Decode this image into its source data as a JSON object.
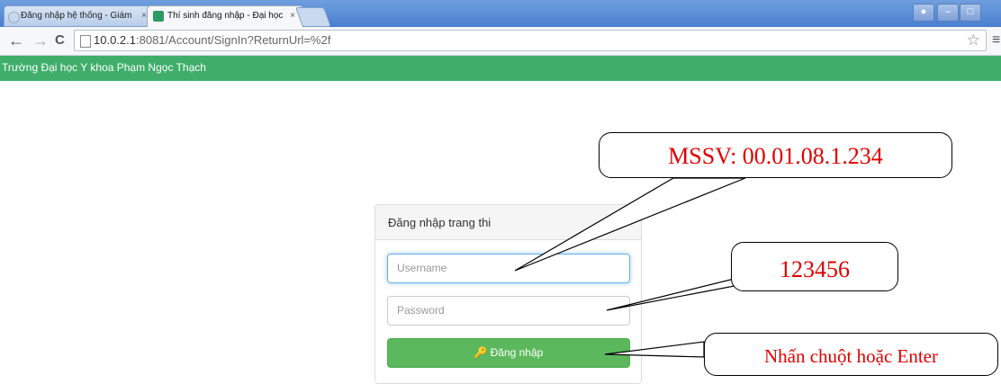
{
  "browser": {
    "tabs": [
      {
        "title": "Đăng nhập hệ thống - Giám",
        "close": "×",
        "active": false
      },
      {
        "title": "Thí sinh đăng nhập - Đại học",
        "close": "×",
        "active": true
      }
    ],
    "url_host": "10.0.2.1",
    "url_rest": ":8081/Account/SignIn?ReturnUrl=%2f",
    "icons": {
      "back": "←",
      "forward": "→",
      "reload": "C",
      "star": "☆",
      "menu": "≡"
    }
  },
  "navbar": {
    "brand": "Trường Đại học Y khoa Phạm Ngọc Thạch"
  },
  "login": {
    "heading": "Đăng nhập trang thi",
    "username_placeholder": "Username",
    "password_placeholder": "Password",
    "submit_label": "Đăng nhập",
    "submit_icon": "🔍"
  },
  "annotations": {
    "username_hint": "MSSV: 00.01.08.1.234",
    "password_hint": "123456",
    "submit_hint": "Nhấn chuột hoặc Enter",
    "color": "#e00000"
  }
}
